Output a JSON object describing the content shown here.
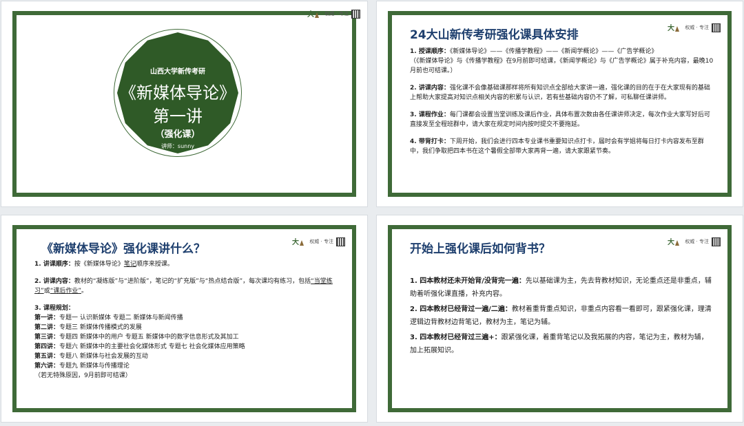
{
  "brand": {
    "logo_text": "大山",
    "slogan": "权威 · 专注"
  },
  "slide1": {
    "university": "山西大学新传考研",
    "course_title": "《新媒体导论》",
    "lecture": "第一讲",
    "type": "（强化课）",
    "teacher": "讲师：sunny"
  },
  "slide2": {
    "title": "24大山新传考研强化课具体安排",
    "sections": [
      {
        "label": "1. 授课顺序：",
        "text": "《新媒体导论》——《传播学教程》——《新闻学概论》——《广告学概论》",
        "text2": "（《新媒体导论》与《传播学教程》在9月前即可结课，《新闻学概论》与《广告学概论》属于补充内容，最晚10月前也可结课。）"
      },
      {
        "label": "2. 讲课内容：",
        "text": "强化课不会像基础课那样将所有知识点全部给大家讲一遍，强化课的目的在于在大家现有的基础上帮助大家提高对知识点相关内容的积累与认识，若有些基础内容仍不了解，可私聊任课讲师。"
      },
      {
        "label": "3. 课程作业：",
        "text": "每门课都会设置当堂训练及课后作业，具体布置次数由各任课讲师决定，每次作业大家写好后可直接发至全程班群中，请大家在规定时间内按时提交不要拖延。"
      },
      {
        "label": "4. 带背打卡：",
        "text": "下周开始，我们会进行四本专业课书重要知识点打卡，届时会有学姐将每日打卡内容发布至群中，我们争取把四本书在这个暑假全部带大家再背一遍，请大家跟紧节奏。"
      }
    ]
  },
  "slide3": {
    "title": "《新媒体导论》强化课讲什么？",
    "item1_label": "1. 讲课顺序：",
    "item1_text_a": "按《新媒体导论》",
    "item1_text_u": "笔记",
    "item1_text_b": "顺序来授课。",
    "item2_label": "2. 讲课内容：",
    "item2_text_a": "教材的“凝练版”与“进阶版”，笔记的“扩充版”与“热点结合版”，每次课均有练习，包括",
    "item2_text_u1": "“当堂练习”",
    "item2_text_mid": "或",
    "item2_text_u2": "“课后作业”",
    "item2_text_end": "。",
    "item3_label": "3. 课程规划：",
    "schedule": [
      {
        "label": "第一讲：",
        "text": "专题一 认识新媒体 专题二 新媒体与新闻传播"
      },
      {
        "label": "第二讲：",
        "text": "专题三 新媒体传播模式的发展"
      },
      {
        "label": "第三讲：",
        "text": "专题四 新媒体中的用户 专题五 新媒体中的数字信息形式及其加工"
      },
      {
        "label": "第四讲：",
        "text": "专题六 新媒体中的主要社会化媒体形式 专题七 社会化媒体应用策略"
      },
      {
        "label": "第五讲：",
        "text": "专题八 新媒体与社会发展的互动"
      },
      {
        "label": "第六讲：",
        "text": "专题九 新媒体与传播理论"
      }
    ],
    "note": "（若无特殊原因，9月前即可结课）"
  },
  "slide4": {
    "title": "开始上强化课后如何背书？",
    "items": [
      {
        "label": "1. 四本教材还未开始背/没背完一遍：",
        "text": "先以基础课为主，先去背教材知识，无论重点还是非重点，辅助着听强化课直播，补充内容。"
      },
      {
        "label": "2. 四本教材已经背过一遍/二遍：",
        "text": "教材着重背重点知识，非重点内容看一看即可，跟紧强化课，理清逻辑边背教材边背笔记，教材为主，笔记为辅。"
      },
      {
        "label": "3. 四本教材已经背过三遍+：",
        "text": "跟紧强化课，着重背笔记以及我拓展的内容，笔记为主，教材为辅，加上拓展知识。"
      }
    ]
  },
  "colors": {
    "frame": "#3f6a38",
    "badge": "#2f5a27",
    "title": "#1e3f6e"
  }
}
